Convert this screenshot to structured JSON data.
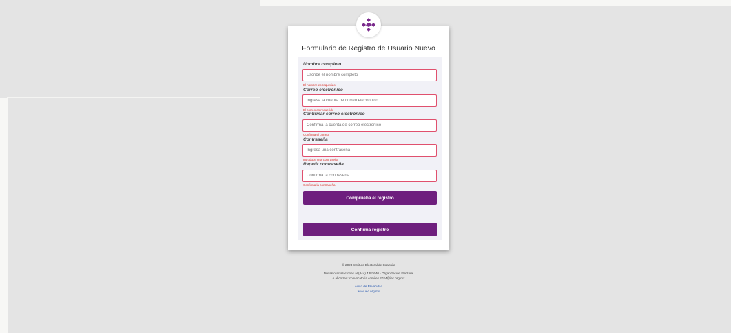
{
  "form": {
    "title": "Formulario de Registro de Usuario Nuevo",
    "fields": [
      {
        "label": "Nombre completo",
        "placeholder": "Escribe el nombre completo",
        "error": "El nombre es requerido"
      },
      {
        "label": "Correo electrónico",
        "placeholder": "Ingresa la cuenta de correo electronico",
        "error": "El correo es requerido"
      },
      {
        "label": "Confirmar correo electrónico",
        "placeholder": "Confirma la cuenta de correo electronico",
        "error": "Confirma el correo"
      },
      {
        "label": "Contraseña",
        "placeholder": "Ingresa una contraseña",
        "error": "Introduce una contraseña"
      },
      {
        "label": "Repetir contraseña",
        "placeholder": "Confirma la contraseña",
        "error": "Confirma la contraseña"
      }
    ],
    "check_button": "Comprueba el registro",
    "confirm_button": "Confirma registro"
  },
  "footer": {
    "copyright": "© 2023 Instituto Electoral de Coahuila",
    "contact_line1": "Dudas o aclaraciones al (844) 4381640 - Organización Electoral",
    "contact_line2": "o al correo: convocatoria.comites.2024@iec.org.mx",
    "privacy_link": "Aviso de Privacidad",
    "site_link": "www.iec.org.mx"
  },
  "colors": {
    "primary": "#6e1f7e",
    "error": "#d9342b",
    "input_border": "#e0506e",
    "background": "#e4e4e4"
  }
}
